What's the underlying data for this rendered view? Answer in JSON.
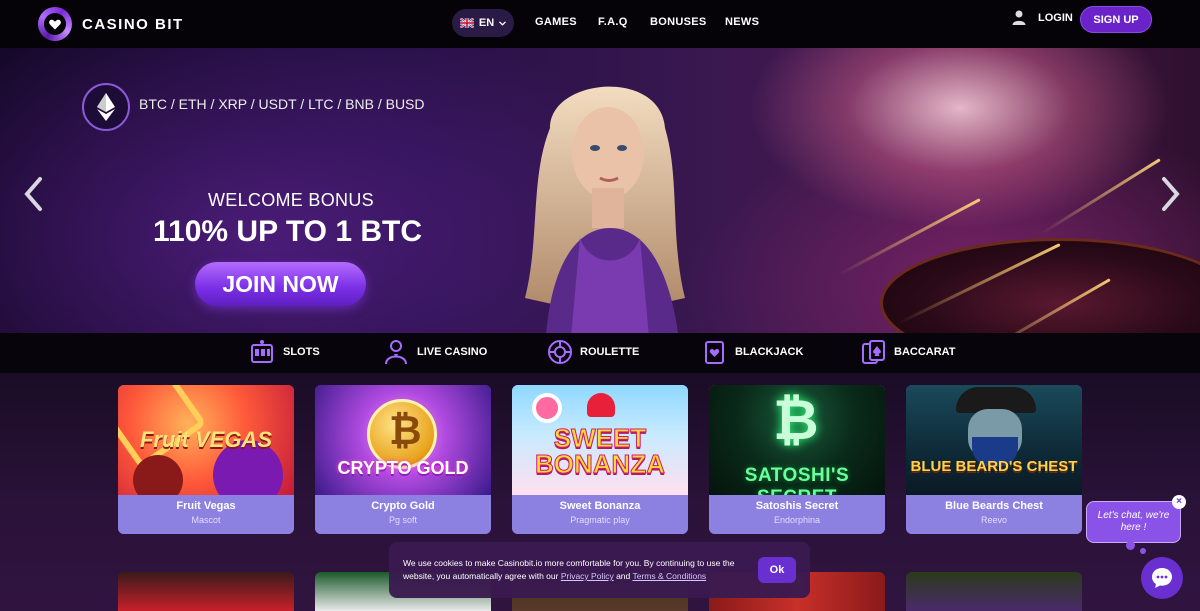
{
  "header": {
    "logo_text": "CASINO BIT",
    "language": "EN",
    "nav": [
      {
        "label": "GAMES"
      },
      {
        "label": "F.A.Q"
      },
      {
        "label": "BONUSES"
      },
      {
        "label": "NEWS"
      }
    ],
    "login_label": "LOGIN",
    "signup_label": "SIGN UP"
  },
  "hero": {
    "crypto_list": "BTC / ETH / XRP / USDT / LTC / BNB / BUSD",
    "welcome": "WELCOME BONUS",
    "bonus": "110% UP TO 1 BTC",
    "cta": "JOIN NOW"
  },
  "categories": [
    {
      "label": "SLOTS",
      "icon": "slot-machine-icon"
    },
    {
      "label": "LIVE CASINO",
      "icon": "dealer-icon"
    },
    {
      "label": "ROULETTE",
      "icon": "roulette-icon"
    },
    {
      "label": "BLACKJACK",
      "icon": "cards-heart-icon"
    },
    {
      "label": "BACCARAT",
      "icon": "cards-spade-icon"
    }
  ],
  "games": [
    {
      "name": "Fruit Vegas",
      "provider": "Mascot",
      "thumb_title": "Fruit VEGAS"
    },
    {
      "name": "Crypto Gold",
      "provider": "Pg soft",
      "thumb_title": "CRYPTO GOLD"
    },
    {
      "name": "Sweet Bonanza",
      "provider": "Pragmatic play",
      "thumb_title": "SWEET BONANZA"
    },
    {
      "name": "Satoshis Secret",
      "provider": "Endorphina",
      "thumb_title": "SATOSHI'S SECRET"
    },
    {
      "name": "Blue Beards Chest",
      "provider": "Reevo",
      "thumb_title": "BLUE BEARD'S CHEST"
    }
  ],
  "cookie": {
    "text_before": "We use cookies to make Casinobit.io more comfortable for you. By continuing to use the website, you automatically agree with our ",
    "privacy_link": "Privacy Policy",
    "and": " and ",
    "terms_link": "Terms & Conditions",
    "ok_label": "Ok"
  },
  "chat": {
    "line1": "Let's chat, we're",
    "line2": "here !",
    "close": "×"
  },
  "colors": {
    "accent": "#6a23c9",
    "card_caption": "#8c80e0",
    "header_bg": "#050307"
  }
}
